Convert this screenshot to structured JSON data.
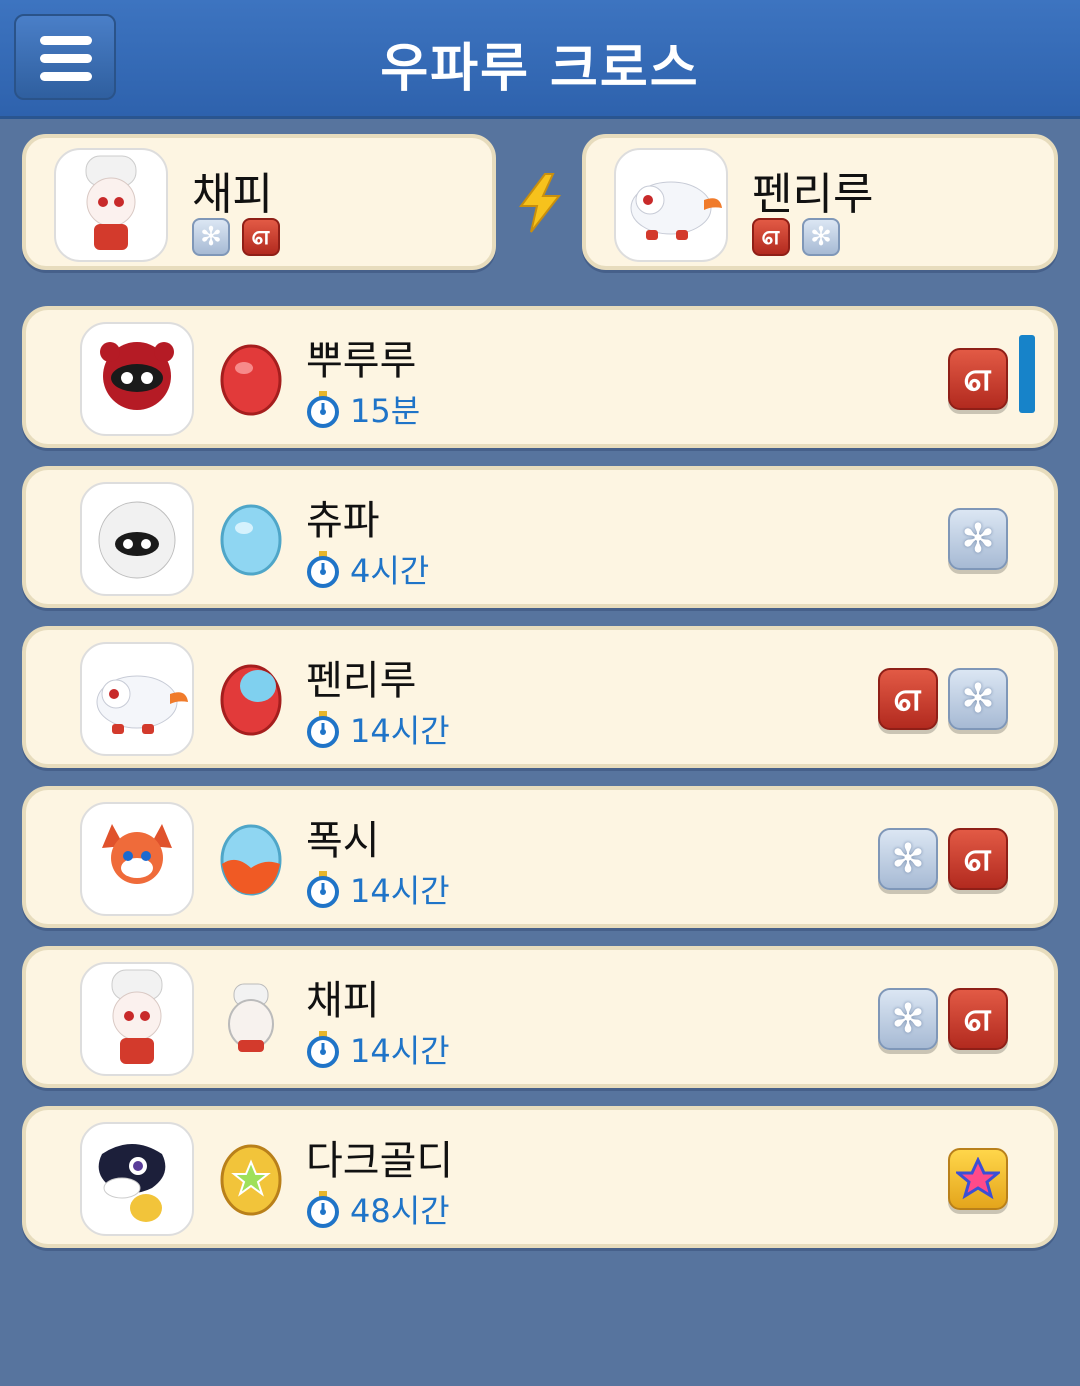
{
  "header": {
    "title": "우파루 크로스"
  },
  "parents": [
    {
      "name": "채피",
      "elements": [
        "ice",
        "fire"
      ]
    },
    {
      "name": "펜리루",
      "elements": [
        "fire",
        "ice"
      ]
    }
  ],
  "results": [
    {
      "name": "뿌루루",
      "time": "15분",
      "egg": "red",
      "elements": [
        "fire"
      ]
    },
    {
      "name": "츄파",
      "time": "4시간",
      "egg": "ice",
      "elements": [
        "ice"
      ]
    },
    {
      "name": "펜리루",
      "time": "14시간",
      "egg": "red-ice",
      "elements": [
        "fire",
        "ice"
      ]
    },
    {
      "name": "폭시",
      "time": "14시간",
      "egg": "ice-fire",
      "elements": [
        "ice",
        "fire"
      ]
    },
    {
      "name": "채피",
      "time": "14시간",
      "egg": "chef",
      "elements": [
        "ice",
        "fire"
      ]
    },
    {
      "name": "다크골디",
      "time": "48시간",
      "egg": "gold",
      "elements": [
        "star"
      ]
    }
  ],
  "icons": {
    "ice": "snowflake-icon",
    "fire": "flame-swirl-icon",
    "star": "rainbow-star-icon"
  },
  "colors": {
    "header": "#2e62ad",
    "background": "#57749e",
    "card": "#fdf5e2",
    "time_text": "#1f74c8"
  }
}
